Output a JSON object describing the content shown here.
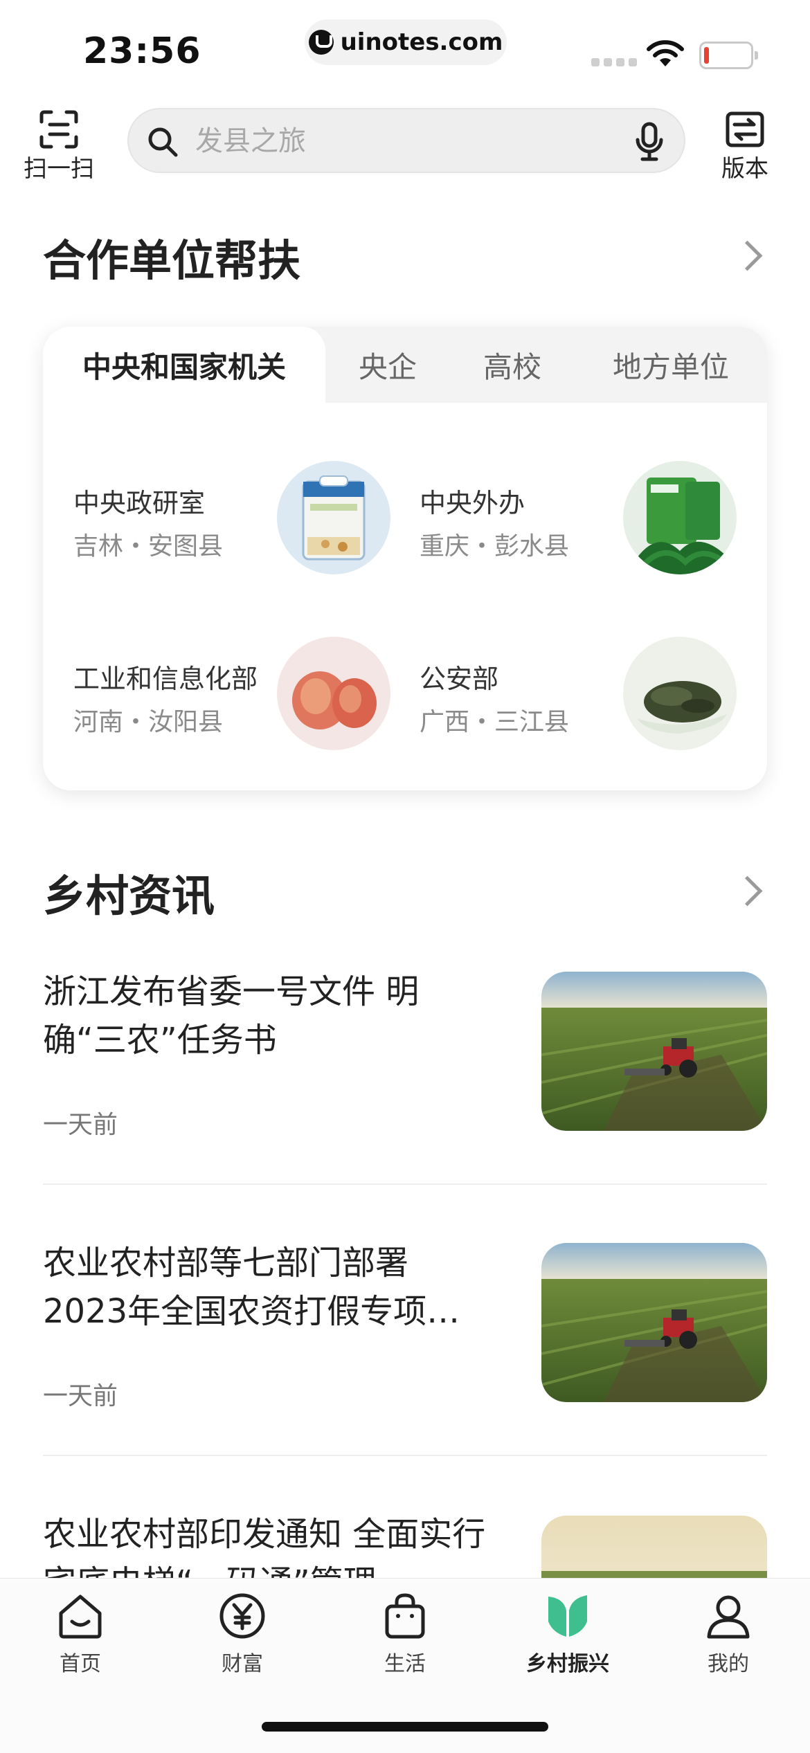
{
  "status_bar": {
    "time": "23:56",
    "url": "uinotes.com"
  },
  "top_bar": {
    "scan_label": "扫一扫",
    "search_placeholder": "发县之旅",
    "version_label": "版本"
  },
  "partner_section": {
    "title": "合作单位帮扶",
    "tabs": [
      "中央和国家机关",
      "央企",
      "高校",
      "地方单位"
    ],
    "items": [
      {
        "org": "中央政研室",
        "location": "吉林・安图县",
        "image": "rice-bag"
      },
      {
        "org": "中央外办",
        "location": "重庆・彭水县",
        "image": "vegetable-pack"
      },
      {
        "org": "工业和信息化部",
        "location": "河南・汝阳县",
        "image": "apples"
      },
      {
        "org": "公安部",
        "location": "广西・三江县",
        "image": "tea-leaves"
      }
    ]
  },
  "news_section": {
    "title": "乡村资讯",
    "items": [
      {
        "title": "浙江发布省委一号文件 明确“三农”任务书",
        "time": "一天前"
      },
      {
        "title": "农业农村部等七部门部署2023年全国农资打假专项…",
        "time": "一天前"
      },
      {
        "title": "农业农村部印发通知 全面实行宅底电梯“一码通”管理",
        "time": ""
      }
    ]
  },
  "tab_bar": {
    "items": [
      {
        "label": "首页",
        "icon": "home-icon"
      },
      {
        "label": "财富",
        "icon": "yuan-icon"
      },
      {
        "label": "生活",
        "icon": "shopping-bag-icon"
      },
      {
        "label": "乡村振兴",
        "icon": "leaf-book-icon",
        "active": true
      },
      {
        "label": "我的",
        "icon": "person-icon"
      }
    ]
  },
  "colors": {
    "accent_green": "#3fbf8f",
    "text": "#222222",
    "muted": "#8a8a8a"
  }
}
